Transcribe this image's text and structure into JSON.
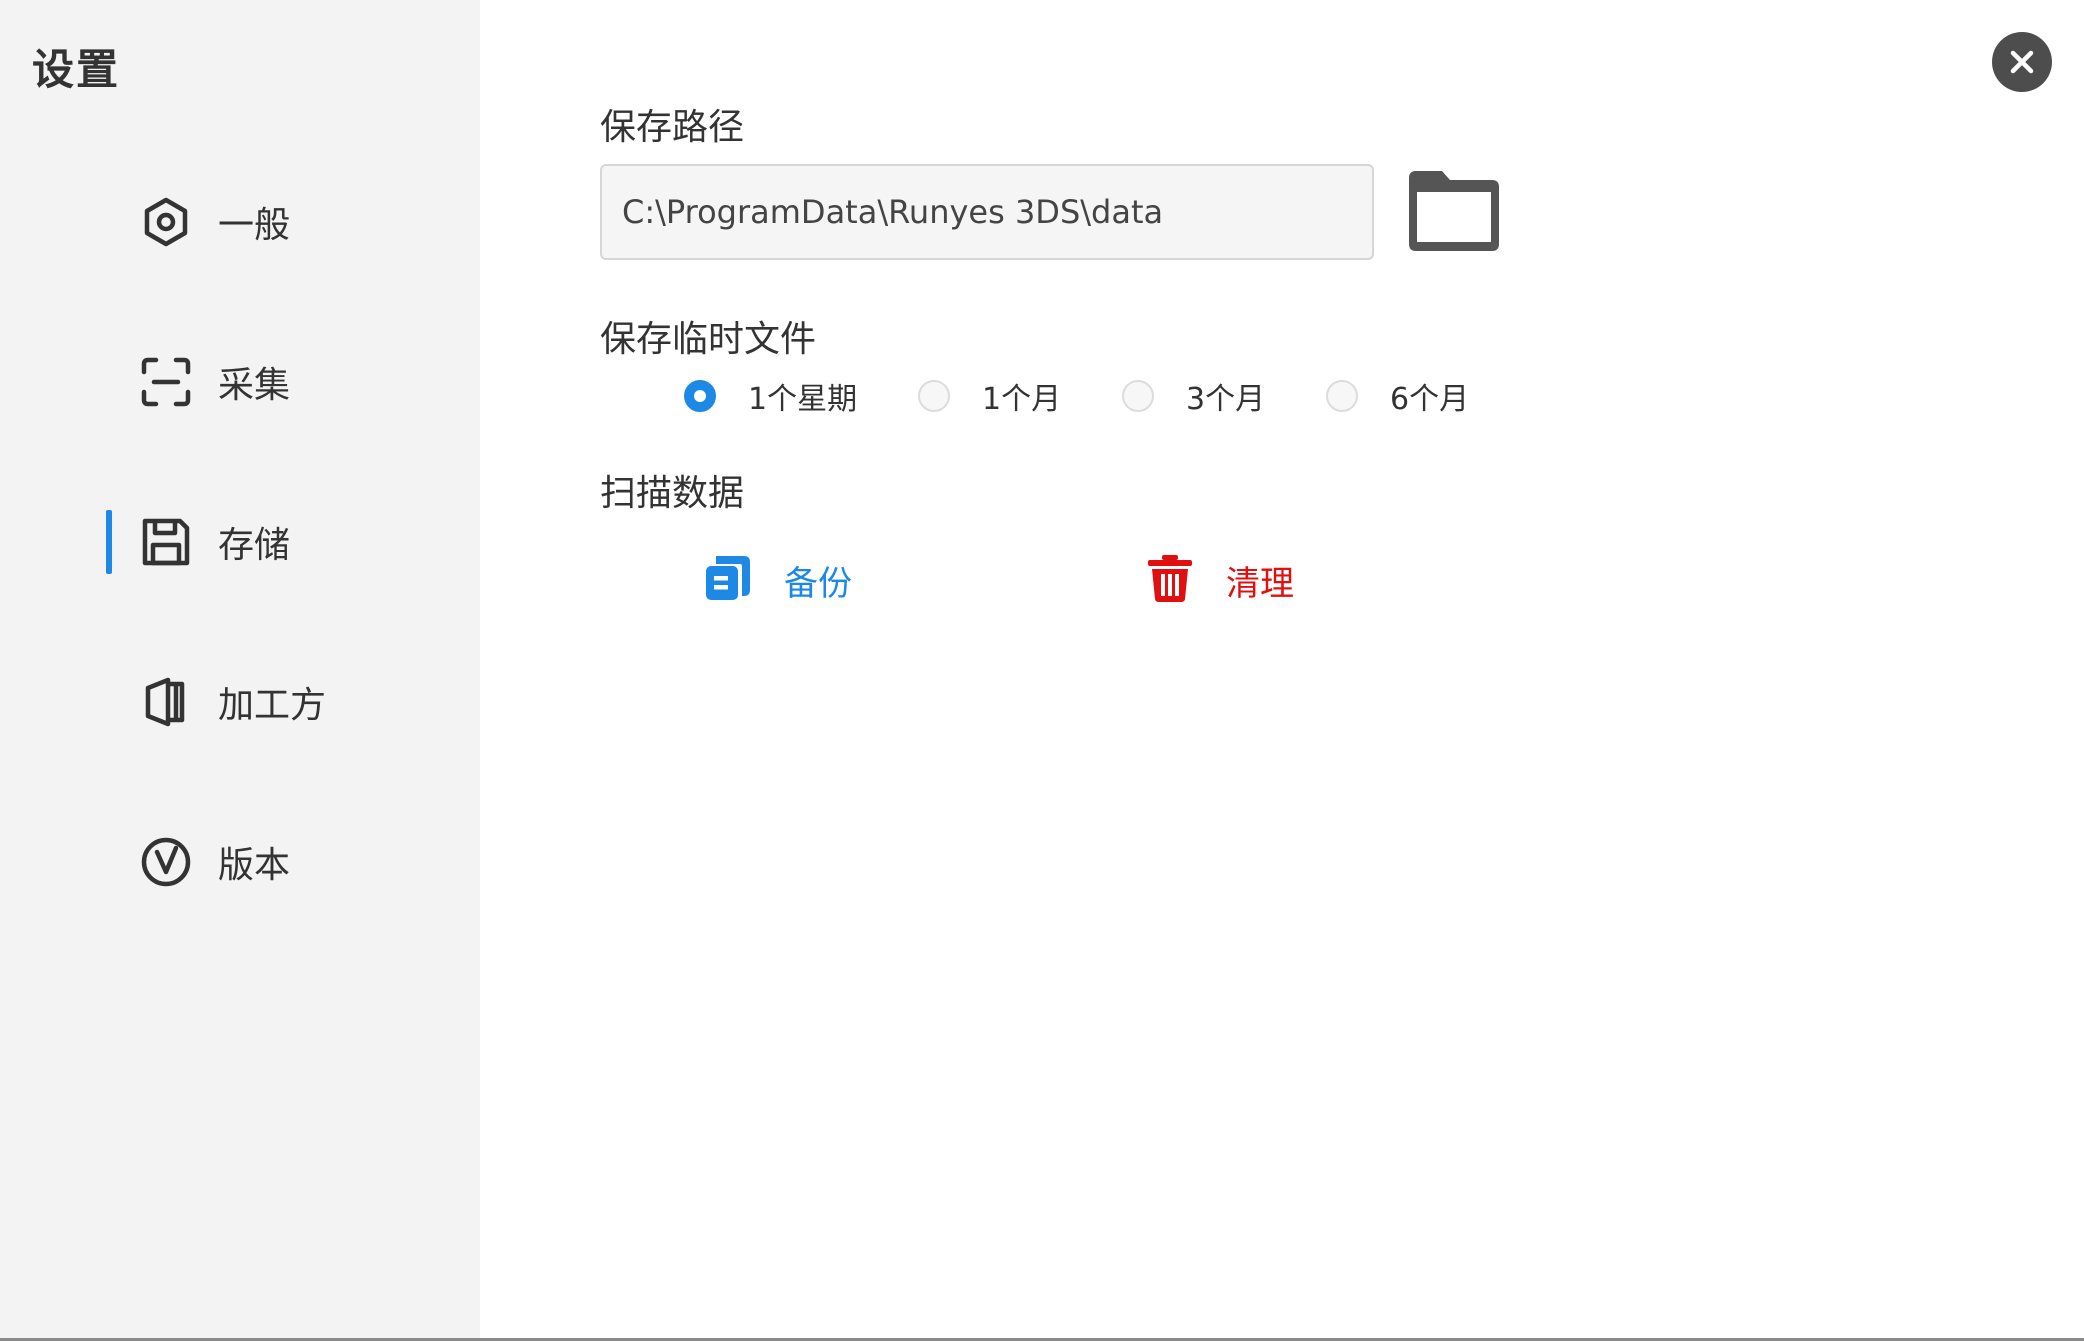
{
  "sidebar": {
    "title": "设置",
    "items": [
      {
        "label": "一般",
        "icon": "hexagon-gear-icon"
      },
      {
        "label": "采集",
        "icon": "scan-icon"
      },
      {
        "label": "存储",
        "icon": "floppy-disk-icon",
        "active": true
      },
      {
        "label": "加工方",
        "icon": "book-icon"
      },
      {
        "label": "版本",
        "icon": "version-v-icon"
      }
    ]
  },
  "header": {
    "close_icon": "close-icon"
  },
  "storage": {
    "save_path": {
      "title": "保存路径",
      "value": "C:\\ProgramData\\Runyes 3DS\\data",
      "browse_icon": "folder-icon"
    },
    "temp_files": {
      "title": "保存临时文件",
      "options": [
        "1个星期",
        "1个月",
        "3个月",
        "6个月"
      ],
      "selected": "1个星期"
    },
    "scan_data": {
      "title": "扫描数据",
      "backup_label": "备份",
      "clean_label": "清理"
    }
  },
  "colors": {
    "accent": "#1e88e5",
    "danger": "#e01010",
    "sidebar_bg": "#f3f3f3",
    "close_bg": "#4d4d4d"
  }
}
